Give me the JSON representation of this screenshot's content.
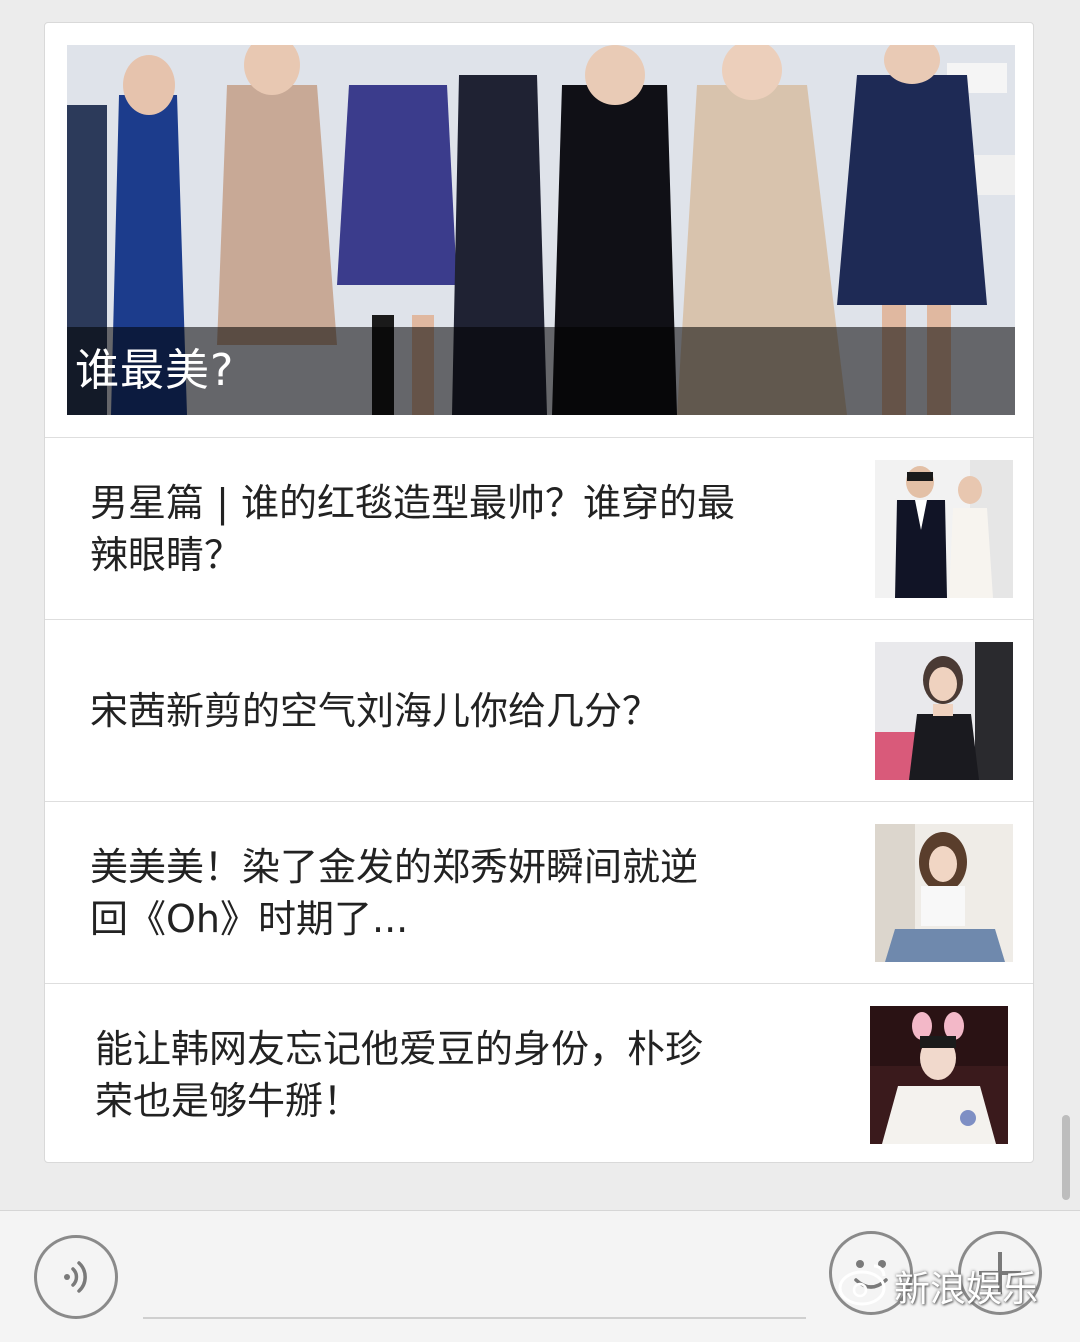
{
  "hero": {
    "title": "谁最美?"
  },
  "articles": [
    {
      "title": "男星篇 | 谁的红毯造型最帅？谁穿的最辣眼睛？",
      "line1": "男星篇 | 谁的红毯造型最帅？谁穿的最",
      "line2": "辣眼睛？"
    },
    {
      "title": "宋茜新剪的空气刘海儿你给几分？",
      "line1": "宋茜新剪的空气刘海儿你给几分？",
      "line2": ""
    },
    {
      "title": "美美美！染了金发的郑秀妍瞬间就逆回《Oh》时期了...",
      "line1": "美美美！染了金发的郑秀妍瞬间就逆",
      "line2": "回《Oh》时期了..."
    },
    {
      "title": "能让韩网友忘记他爱豆的身份，朴珍荣也是够牛掰！",
      "line1": "能让韩网友忘记他爱豆的身份，朴珍",
      "line2": "荣也是够牛掰！"
    }
  ],
  "composer": {
    "voice_icon": "voice-icon",
    "emoji_icon": "emoji-icon",
    "plus_icon": "plus-icon"
  },
  "watermark": {
    "text": "新浪娱乐"
  },
  "colors": {
    "background": "#ececec",
    "card": "#ffffff",
    "text": "#222222",
    "caption_overlay": "rgba(0,0,0,0.55)"
  }
}
